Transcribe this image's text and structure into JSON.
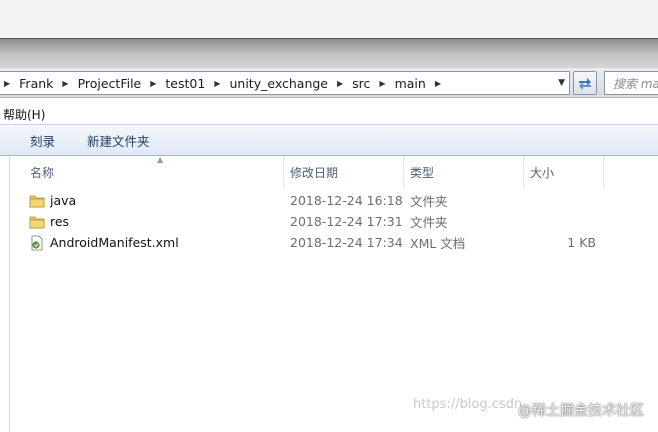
{
  "address": {
    "breadcrumbs": [
      "Frank",
      "ProjectFile",
      "test01",
      "unity_exchange",
      "src",
      "main"
    ],
    "search_placeholder": "搜索 ma"
  },
  "menu": {
    "help": "帮助(H)"
  },
  "toolbar": {
    "burn": "刻录",
    "new_folder": "新建文件夹"
  },
  "columns": {
    "name": "名称",
    "date": "修改日期",
    "type": "类型",
    "size": "大小"
  },
  "files": [
    {
      "name": "java",
      "modified": "2018-12-24 16:18",
      "type": "文件夹",
      "size": "",
      "icon": "folder-icon"
    },
    {
      "name": "res",
      "modified": "2018-12-24 17:31",
      "type": "文件夹",
      "size": "",
      "icon": "folder-icon"
    },
    {
      "name": "AndroidManifest.xml",
      "modified": "2018-12-24 17:34",
      "type": "XML 文档",
      "size": "1 KB",
      "icon": "xml-file-icon"
    }
  ],
  "watermark": {
    "url": "https://blog.csdn",
    "brand": "@稀土掘金技术社区"
  },
  "colors": {
    "column_header_text": "#4c607a",
    "toolbar_text": "#1e3b5e",
    "folder": "#e8c25a"
  }
}
